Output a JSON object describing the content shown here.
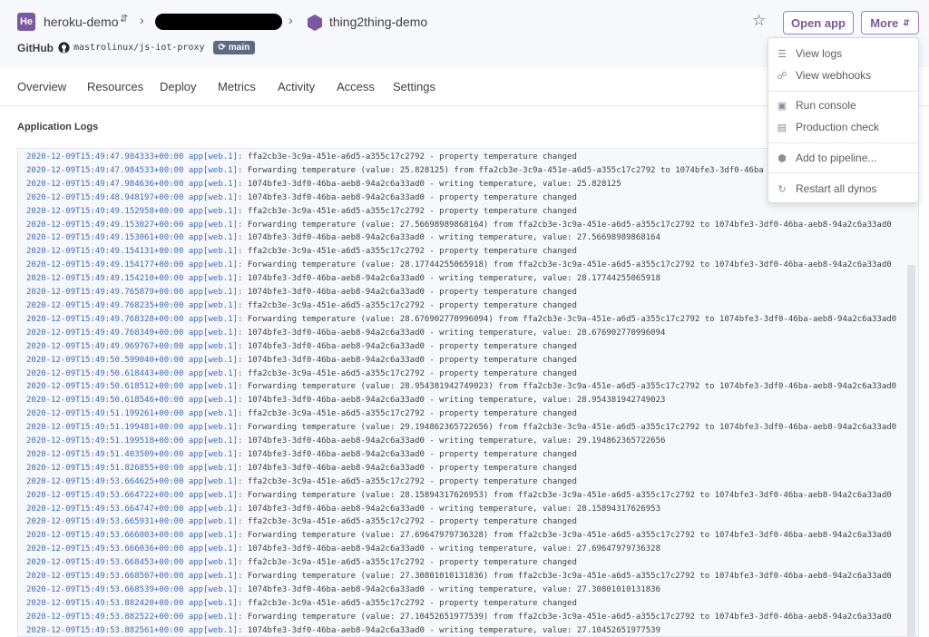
{
  "header": {
    "app_badge": "He",
    "pipeline_name": "heroku-demo",
    "app_name": "thing2thing-demo",
    "github_label": "GitHub",
    "repo": "mastrolinux/js-iot-proxy",
    "branch": "main",
    "open_app_label": "Open app",
    "more_label": "More"
  },
  "tabs": [
    "Overview",
    "Resources",
    "Deploy",
    "Metrics",
    "Activity",
    "Access",
    "Settings"
  ],
  "logs": {
    "title": "Application Logs",
    "lines": [
      {
        "ts": "2020-12-09T15:49:47.984333+00:00",
        "src": "app[web.1]:",
        "msg": "ffa2cb3e-3c9a-451e-a6d5-a355c17c2792 - property temperature changed"
      },
      {
        "ts": "2020-12-09T15:49:47.984533+00:00",
        "src": "app[web.1]:",
        "msg": "Forwarding temperature (value: 25.828125) from ffa2cb3e-3c9a-451e-a6d5-a355c17c2792 to 1074bfe3-3df0-46ba"
      },
      {
        "ts": "2020-12-09T15:49:47.984636+00:00",
        "src": "app[web.1]:",
        "msg": "1074bfe3-3df0-46ba-aeb8-94a2c6a33ad0 - writing temperature, value: 25.828125"
      },
      {
        "ts": "2020-12-09T15:49:48.948197+00:00",
        "src": "app[web.1]:",
        "msg": "1074bfe3-3df0-46ba-aeb8-94a2c6a33ad0 - property temperature changed"
      },
      {
        "ts": "2020-12-09T15:49:49.152958+00:00",
        "src": "app[web.1]:",
        "msg": "ffa2cb3e-3c9a-451e-a6d5-a355c17c2792 - property temperature changed"
      },
      {
        "ts": "2020-12-09T15:49:49.153027+00:00",
        "src": "app[web.1]:",
        "msg": "Forwarding temperature (value: 27.56698989868164) from ffa2cb3e-3c9a-451e-a6d5-a355c17c2792 to 1074bfe3-3df0-46ba-aeb8-94a2c6a33ad0"
      },
      {
        "ts": "2020-12-09T15:49:49.153061+00:00",
        "src": "app[web.1]:",
        "msg": "1074bfe3-3df0-46ba-aeb8-94a2c6a33ad0 - writing temperature, value: 27.56698989868164"
      },
      {
        "ts": "2020-12-09T15:49:49.154131+00:00",
        "src": "app[web.1]:",
        "msg": "ffa2cb3e-3c9a-451e-a6d5-a355c17c2792 - property temperature changed"
      },
      {
        "ts": "2020-12-09T15:49:49.154177+00:00",
        "src": "app[web.1]:",
        "msg": "Forwarding temperature (value: 28.17744255065918) from ffa2cb3e-3c9a-451e-a6d5-a355c17c2792 to 1074bfe3-3df0-46ba-aeb8-94a2c6a33ad0"
      },
      {
        "ts": "2020-12-09T15:49:49.154210+00:00",
        "src": "app[web.1]:",
        "msg": "1074bfe3-3df0-46ba-aeb8-94a2c6a33ad0 - writing temperature, value: 28.17744255065918"
      },
      {
        "ts": "2020-12-09T15:49:49.765879+00:00",
        "src": "app[web.1]:",
        "msg": "1074bfe3-3df0-46ba-aeb8-94a2c6a33ad0 - property temperature changed"
      },
      {
        "ts": "2020-12-09T15:49:49.768235+00:00",
        "src": "app[web.1]:",
        "msg": "ffa2cb3e-3c9a-451e-a6d5-a355c17c2792 - property temperature changed"
      },
      {
        "ts": "2020-12-09T15:49:49.768328+00:00",
        "src": "app[web.1]:",
        "msg": "Forwarding temperature (value: 28.676902770996094) from ffa2cb3e-3c9a-451e-a6d5-a355c17c2792 to 1074bfe3-3df0-46ba-aeb8-94a2c6a33ad0"
      },
      {
        "ts": "2020-12-09T15:49:49.768349+00:00",
        "src": "app[web.1]:",
        "msg": "1074bfe3-3df0-46ba-aeb8-94a2c6a33ad0 - writing temperature, value: 28.676902770996094"
      },
      {
        "ts": "2020-12-09T15:49:49.969767+00:00",
        "src": "app[web.1]:",
        "msg": "1074bfe3-3df0-46ba-aeb8-94a2c6a33ad0 - property temperature changed"
      },
      {
        "ts": "2020-12-09T15:49:50.599040+00:00",
        "src": "app[web.1]:",
        "msg": "1074bfe3-3df0-46ba-aeb8-94a2c6a33ad0 - property temperature changed"
      },
      {
        "ts": "2020-12-09T15:49:50.618443+00:00",
        "src": "app[web.1]:",
        "msg": "ffa2cb3e-3c9a-451e-a6d5-a355c17c2792 - property temperature changed"
      },
      {
        "ts": "2020-12-09T15:49:50.618512+00:00",
        "src": "app[web.1]:",
        "msg": "Forwarding temperature (value: 28.954381942749023) from ffa2cb3e-3c9a-451e-a6d5-a355c17c2792 to 1074bfe3-3df0-46ba-aeb8-94a2c6a33ad0"
      },
      {
        "ts": "2020-12-09T15:49:50.618546+00:00",
        "src": "app[web.1]:",
        "msg": "1074bfe3-3df0-46ba-aeb8-94a2c6a33ad0 - writing temperature, value: 28.954381942749023"
      },
      {
        "ts": "2020-12-09T15:49:51.199261+00:00",
        "src": "app[web.1]:",
        "msg": "ffa2cb3e-3c9a-451e-a6d5-a355c17c2792 - property temperature changed"
      },
      {
        "ts": "2020-12-09T15:49:51.199481+00:00",
        "src": "app[web.1]:",
        "msg": "Forwarding temperature (value: 29.194862365722656) from ffa2cb3e-3c9a-451e-a6d5-a355c17c2792 to 1074bfe3-3df0-46ba-aeb8-94a2c6a33ad0"
      },
      {
        "ts": "2020-12-09T15:49:51.199518+00:00",
        "src": "app[web.1]:",
        "msg": "1074bfe3-3df0-46ba-aeb8-94a2c6a33ad0 - writing temperature, value: 29.194862365722656"
      },
      {
        "ts": "2020-12-09T15:49:51.403509+00:00",
        "src": "app[web.1]:",
        "msg": "1074bfe3-3df0-46ba-aeb8-94a2c6a33ad0 - property temperature changed"
      },
      {
        "ts": "2020-12-09T15:49:51.826855+00:00",
        "src": "app[web.1]:",
        "msg": "1074bfe3-3df0-46ba-aeb8-94a2c6a33ad0 - property temperature changed"
      },
      {
        "ts": "2020-12-09T15:49:53.664625+00:00",
        "src": "app[web.1]:",
        "msg": "ffa2cb3e-3c9a-451e-a6d5-a355c17c2792 - property temperature changed"
      },
      {
        "ts": "2020-12-09T15:49:53.664722+00:00",
        "src": "app[web.1]:",
        "msg": "Forwarding temperature (value: 28.15894317626953) from ffa2cb3e-3c9a-451e-a6d5-a355c17c2792 to 1074bfe3-3df0-46ba-aeb8-94a2c6a33ad0"
      },
      {
        "ts": "2020-12-09T15:49:53.664747+00:00",
        "src": "app[web.1]:",
        "msg": "1074bfe3-3df0-46ba-aeb8-94a2c6a33ad0 - writing temperature, value: 28.15894317626953"
      },
      {
        "ts": "2020-12-09T15:49:53.665931+00:00",
        "src": "app[web.1]:",
        "msg": "ffa2cb3e-3c9a-451e-a6d5-a355c17c2792 - property temperature changed"
      },
      {
        "ts": "2020-12-09T15:49:53.666003+00:00",
        "src": "app[web.1]:",
        "msg": "Forwarding temperature (value: 27.69647979736328) from ffa2cb3e-3c9a-451e-a6d5-a355c17c2792 to 1074bfe3-3df0-46ba-aeb8-94a2c6a33ad0"
      },
      {
        "ts": "2020-12-09T15:49:53.666036+00:00",
        "src": "app[web.1]:",
        "msg": "1074bfe3-3df0-46ba-aeb8-94a2c6a33ad0 - writing temperature, value: 27.69647979736328"
      },
      {
        "ts": "2020-12-09T15:49:53.668453+00:00",
        "src": "app[web.1]:",
        "msg": "ffa2cb3e-3c9a-451e-a6d5-a355c17c2792 - property temperature changed"
      },
      {
        "ts": "2020-12-09T15:49:53.668507+00:00",
        "src": "app[web.1]:",
        "msg": "Forwarding temperature (value: 27.30801010131836) from ffa2cb3e-3c9a-451e-a6d5-a355c17c2792 to 1074bfe3-3df0-46ba-aeb8-94a2c6a33ad0"
      },
      {
        "ts": "2020-12-09T15:49:53.668539+00:00",
        "src": "app[web.1]:",
        "msg": "1074bfe3-3df0-46ba-aeb8-94a2c6a33ad0 - writing temperature, value: 27.30801010131836"
      },
      {
        "ts": "2020-12-09T15:49:53.882420+00:00",
        "src": "app[web.1]:",
        "msg": "ffa2cb3e-3c9a-451e-a6d5-a355c17c2792 - property temperature changed"
      },
      {
        "ts": "2020-12-09T15:49:53.882522+00:00",
        "src": "app[web.1]:",
        "msg": "Forwarding temperature (value: 27.10452651977539) from ffa2cb3e-3c9a-451e-a6d5-a355c17c2792 to 1074bfe3-3df0-46ba-aeb8-94a2c6a33ad0"
      },
      {
        "ts": "2020-12-09T15:49:53.882561+00:00",
        "src": "app[web.1]:",
        "msg": "1074bfe3-3df0-46ba-aeb8-94a2c6a33ad0 - writing temperature, value: 27.10452651977539"
      }
    ]
  },
  "more_menu": {
    "items": [
      {
        "label": "View logs",
        "icon": "logs-icon"
      },
      {
        "label": "View webhooks",
        "icon": "webhooks-icon"
      },
      {
        "label": "Run console",
        "icon": "console-icon"
      },
      {
        "label": "Production check",
        "icon": "clipboard-icon"
      },
      {
        "label": "Add to pipeline...",
        "icon": "pipeline-icon"
      },
      {
        "label": "Restart all dynos",
        "icon": "restart-icon"
      }
    ]
  },
  "colors": {
    "brand": "#79589f",
    "log_timestamp": "#3c6cc2",
    "branch_badge": "#5c6a85"
  }
}
